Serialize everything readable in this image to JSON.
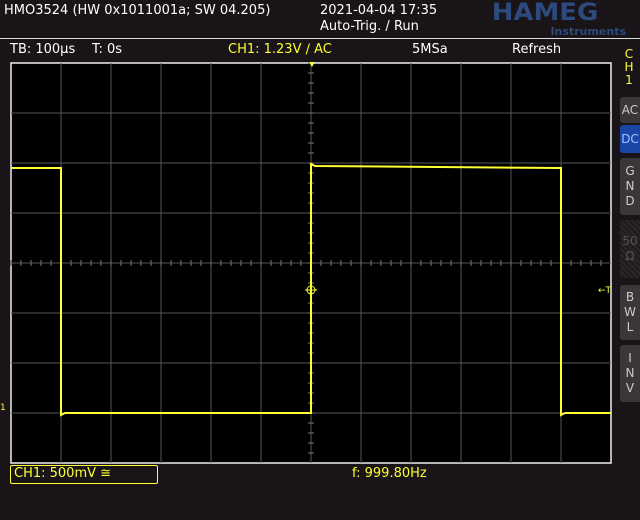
{
  "header": {
    "device": "HMO3524 (HW 0x1011001a; SW 04.205)",
    "datetime": "2021-04-04 17:35",
    "trigger_status": "Auto-Trig. / Run",
    "logo": "HAMEG",
    "logo_sub": "Instruments"
  },
  "status": {
    "timebase": "TB: 100µs",
    "trigger_time": "T: 0s",
    "ch1_trigger": "CH1: 1.23V ∕ AC",
    "sample_rate": "5MSa",
    "mode": "Refresh"
  },
  "side": {
    "channel": "CH1",
    "buttons": [
      {
        "label": "AC"
      },
      {
        "label": "DC",
        "selected": true
      },
      {
        "label": "GND"
      },
      {
        "label": "50Ω",
        "disabled": true
      },
      {
        "label": "BWL"
      },
      {
        "label": "INV"
      }
    ]
  },
  "bottom": {
    "ch1_scale": "CH1: 500mV ≅",
    "frequency": "f: 999.80Hz"
  },
  "markers": {
    "trigger_level": "←T",
    "ground": "1"
  },
  "colors": {
    "trace": "#ffff33",
    "accent": "#1b46a8",
    "logo": "#2c4a7c"
  },
  "waveform": {
    "type": "square",
    "frequency_hz": 999.8,
    "high_div": 1.9,
    "low_div": -3.0,
    "edges_div": [
      -5,
      0,
      5
    ]
  }
}
